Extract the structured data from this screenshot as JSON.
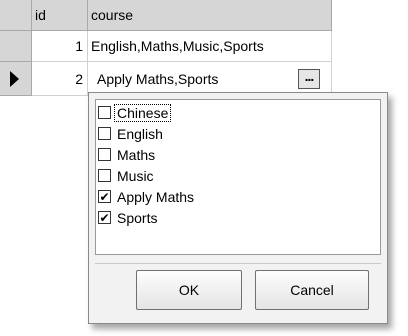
{
  "grid": {
    "columns": [
      "id",
      "course"
    ],
    "rows": [
      {
        "id": "1",
        "course": "English,Maths,Music,Sports"
      },
      {
        "id": "2",
        "course": "Apply Maths,Sports",
        "current": true
      }
    ],
    "editor_button": "..."
  },
  "dropdown": {
    "items": [
      {
        "label": "Chinese",
        "checked": false,
        "check": "",
        "focused": true
      },
      {
        "label": "English",
        "checked": false,
        "check": ""
      },
      {
        "label": "Maths",
        "checked": false,
        "check": ""
      },
      {
        "label": "Music",
        "checked": false,
        "check": ""
      },
      {
        "label": "Apply Maths",
        "checked": true,
        "check": "✔"
      },
      {
        "label": "Sports",
        "checked": true,
        "check": "✔"
      }
    ],
    "ok_label": "OK",
    "cancel_label": "Cancel"
  }
}
